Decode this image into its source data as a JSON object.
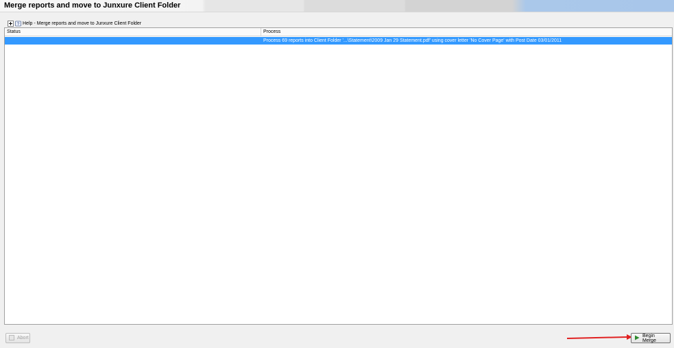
{
  "header": {
    "title": "Merge reports and move to Junxure Client Folder"
  },
  "help": {
    "label": "Help - Merge reports and move to Junxure Client Folder",
    "icon": "help-book-icon",
    "expand_icon": "plus-box-icon"
  },
  "table": {
    "columns": [
      "Status",
      "Process"
    ],
    "rows": [
      {
        "status": "",
        "process": "Process 69 reports into Client Folder '...\\Statement\\2009 Jan 29 Statement.pdf' using cover letter 'No Cover Page' with Post Date 03/01/2011",
        "selected": true
      }
    ]
  },
  "buttons": {
    "abort": {
      "label": "Abort",
      "icon": "abort-icon",
      "enabled": false
    },
    "begin_merge": {
      "label": "Begin Merge",
      "icon": "play-icon",
      "enabled": true
    }
  },
  "colors": {
    "selection": "#3399ff",
    "annotation_arrow": "#e02020",
    "play_icon": "#2e8b2e"
  }
}
